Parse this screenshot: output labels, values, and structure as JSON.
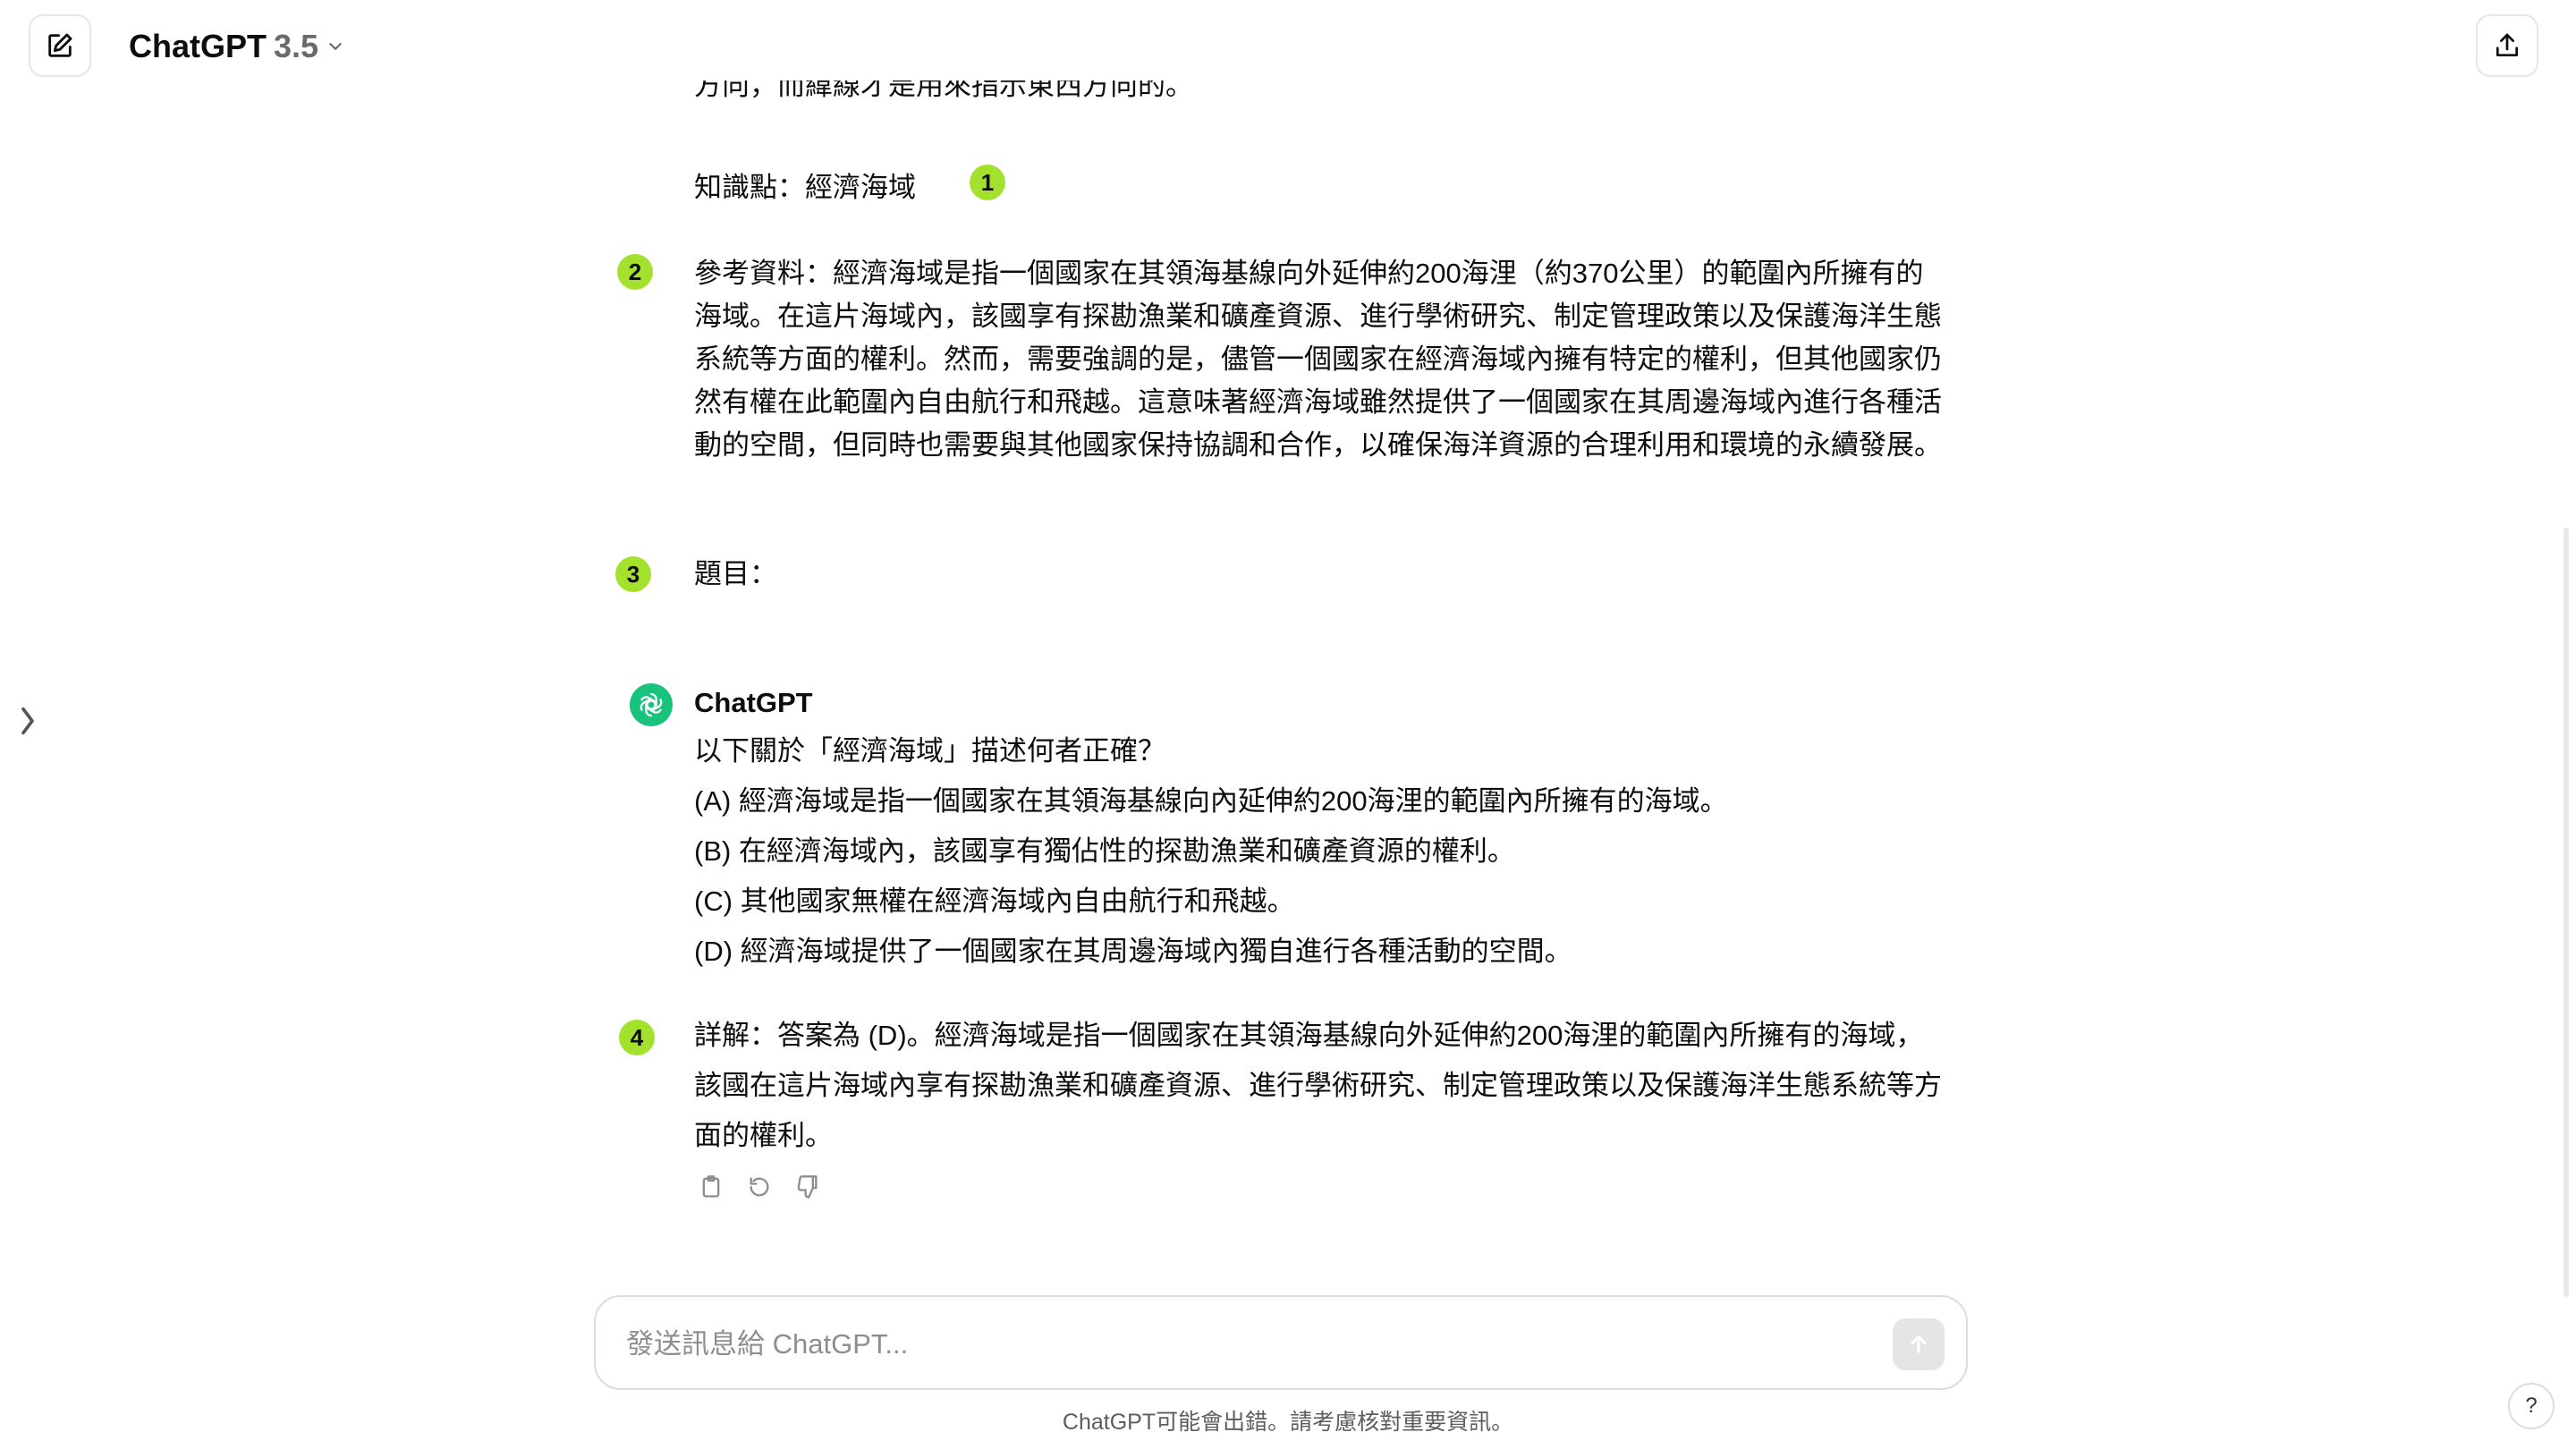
{
  "header": {
    "model_name": "ChatGPT",
    "model_version": "3.5",
    "new_chat_icon": "edit-icon",
    "share_icon": "share-icon"
  },
  "conversation": {
    "cut_line": "方向，而緯線才是用來指示東西方向的。",
    "knowledge_point": "知識點：經濟海域",
    "reference": "參考資料：經濟海域是指一個國家在其領海基線向外延伸約200海浬（約370公里）的範圍內所擁有的海域。在這片海域內，該國享有探勘漁業和礦產資源、進行學術研究、制定管理政策以及保護海洋生態系統等方面的權利。然而，需要強調的是，儘管一個國家在經濟海域內擁有特定的權利，但其他國家仍然有權在此範圍內自由航行和飛越。這意味著經濟海域雖然提供了一個國家在其周邊海域內進行各種活動的空間，但同時也需要與其他國家保持協調和合作，以確保海洋資源的合理利用和環境的永續發展。",
    "question_label": "題目："
  },
  "assistant": {
    "name": "ChatGPT",
    "question": "以下關於「經濟海域」描述何者正確？",
    "options": [
      "(A) 經濟海域是指一個國家在其領海基線向內延伸約200海浬的範圍內所擁有的海域。",
      "(B) 在經濟海域內，該國享有獨佔性的探勘漁業和礦產資源的權利。",
      "(C) 其他國家無權在經濟海域內自由航行和飛越。",
      "(D) 經濟海域提供了一個國家在其周邊海域內獨自進行各種活動的空間。"
    ],
    "explanation": "詳解：答案為 (D)。經濟海域是指一個國家在其領海基線向外延伸約200海浬的範圍內所擁有的海域，該國在這片海域內享有探勘漁業和礦產資源、進行學術研究、制定管理政策以及保護海洋生態系統等方面的權利。"
  },
  "badges": [
    "1",
    "2",
    "3",
    "4"
  ],
  "composer": {
    "placeholder": "發送訊息給 ChatGPT..."
  },
  "footer": {
    "disclaimer": "ChatGPT可能會出錯。請考慮核對重要資訊。",
    "help": "?"
  },
  "colors": {
    "badge": "#a4e12e",
    "avatar": "#19c37d"
  }
}
